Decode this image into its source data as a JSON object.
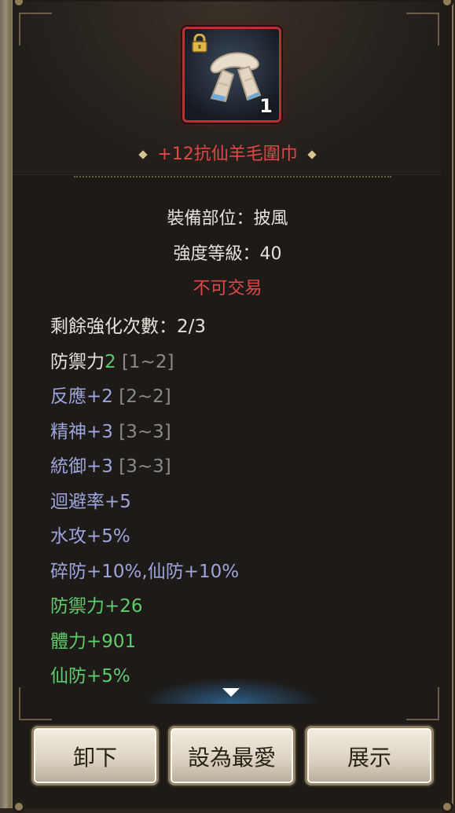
{
  "item": {
    "count": "1",
    "locked": true,
    "icon": "scarf-icon",
    "name": "+12抗仙羊毛圍巾",
    "name_color": "#e04848"
  },
  "info": {
    "slot": "裝備部位：披風",
    "level": "強度等級：40",
    "trade": "不可交易"
  },
  "stats": {
    "enhance": "剩餘強化次數：2/3",
    "defense_label": "防禦力",
    "defense_value": "2",
    "defense_range": "[1~2]",
    "reaction_label": "反應+2",
    "reaction_range": "[2~2]",
    "spirit_label": "精神+3",
    "spirit_range": "[3~3]",
    "command_label": "統御+3",
    "command_range": "[3~3]",
    "evasion": "迴避率+5",
    "water_attack": "水攻+5%",
    "break_defense": "碎防+10%,仙防+10%",
    "bonus_defense": "防禦力+26",
    "bonus_hp": "體力+901",
    "bonus_immortal": "仙防+5%"
  },
  "buttons": {
    "unequip": "卸下",
    "favorite": "設為最愛",
    "show": "展示"
  },
  "colors": {
    "white_text": "#e6e2da",
    "blue_text": "#9da6dc",
    "green_text": "#5fcc6c",
    "range_text": "#8a8a8a",
    "red_text": "#e04848"
  }
}
